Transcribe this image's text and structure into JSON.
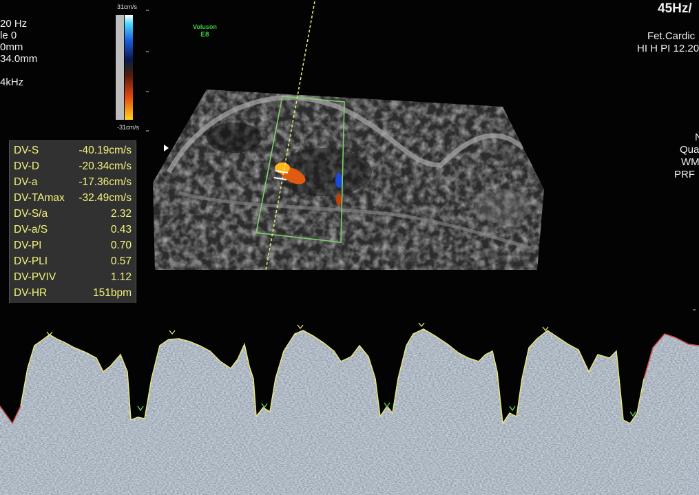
{
  "left_params": {
    "line1": "20 Hz",
    "line2": "le  0",
    "line3": "0mm",
    "line4": "34.0mm",
    "line5": "4kHz"
  },
  "right_top": {
    "frame_rate": "45Hz/",
    "preset": "Fet.Cardic",
    "probe_settings": "HI H PI 12.20"
  },
  "right_mid": {
    "line1": "N",
    "line2": "Qua",
    "line3": "WM",
    "line4": "PRF"
  },
  "vendor_logo": {
    "brand": "Voluson",
    "model": "E8"
  },
  "color_scale": {
    "top_label": "31cm/s",
    "bottom_label": "-31cm/s"
  },
  "measurements": [
    {
      "label": "DV-S",
      "value": "-40.19cm/s"
    },
    {
      "label": "DV-D",
      "value": "-20.34cm/s"
    },
    {
      "label": "DV-a",
      "value": "-17.36cm/s"
    },
    {
      "label": "DV-TAmax",
      "value": "-32.49cm/s"
    },
    {
      "label": "DV-S/a",
      "value": "2.32"
    },
    {
      "label": "DV-a/S",
      "value": "0.43"
    },
    {
      "label": "DV-PI",
      "value": "0.70"
    },
    {
      "label": "DV-PLI",
      "value": "0.57"
    },
    {
      "label": "DV-PVIV",
      "value": "1.12"
    },
    {
      "label": "DV-HR",
      "value": "151bpm"
    }
  ],
  "colors": {
    "measurement_text": "#f4f37a",
    "trace_line": "#e8e87a",
    "sample_gate": "#7fd06a",
    "logo": "#3fcf3f"
  }
}
